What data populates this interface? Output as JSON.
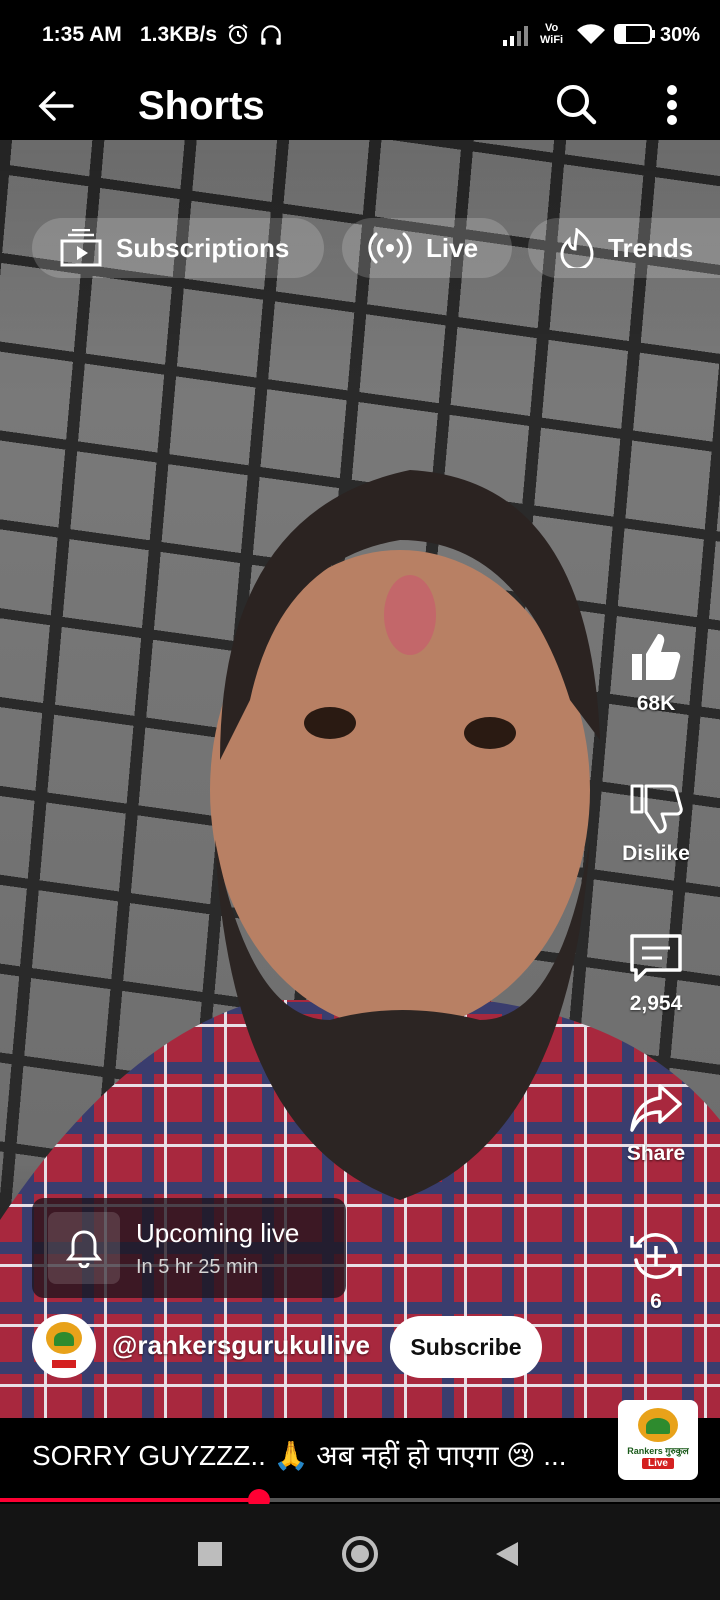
{
  "status_bar": {
    "time": "1:35 AM",
    "net_speed": "1.3KB/s",
    "wifi_label_top": "Vo",
    "wifi_label_bottom": "WiFi",
    "battery": "30%",
    "icons": [
      "alarm-icon",
      "headphones-icon",
      "signal-icon",
      "wifi-icon",
      "battery-icon"
    ]
  },
  "top_bar": {
    "title": "Shorts",
    "icons": [
      "back-arrow-icon",
      "search-icon",
      "more-vert-icon"
    ]
  },
  "chips": [
    {
      "label": "Subscriptions",
      "icon": "subscriptions-icon"
    },
    {
      "label": "Live",
      "icon": "live-icon"
    },
    {
      "label": "Trends",
      "icon": "trends-icon"
    }
  ],
  "actions": {
    "like": "68K",
    "dislike": "Dislike",
    "comments": "2,954",
    "share": "Share",
    "remix": "6"
  },
  "upcoming": {
    "title": "Upcoming live",
    "time": "In 5 hr 25 min"
  },
  "channel": {
    "handle": "@rankersgurukullive",
    "subscribe_label": "Subscribe",
    "logo_text": "Rankers गुरुकुल",
    "logo_badge": "Live"
  },
  "caption": "SORRY GUYZZZ.. 🙏 अब नहीं हो पाएगा 😢 ...",
  "progress": 0.36,
  "colors": {
    "progress": "#ff0033",
    "subscribe_bg": "#ffffff"
  }
}
